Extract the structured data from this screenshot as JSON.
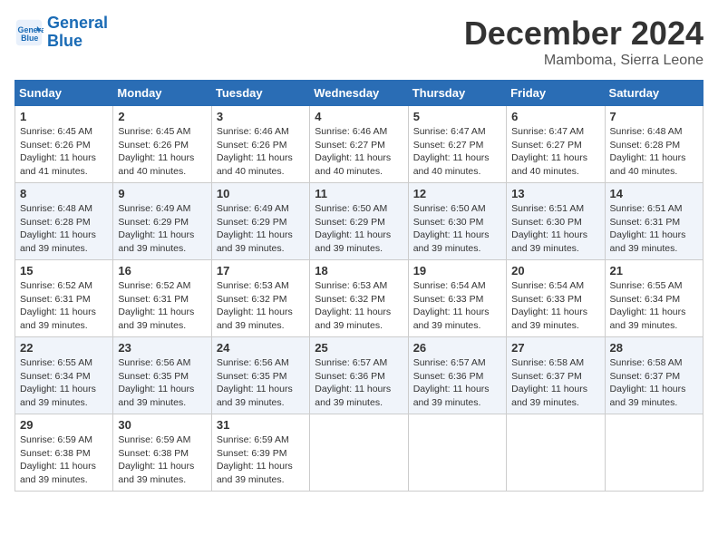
{
  "logo": {
    "line1": "General",
    "line2": "Blue"
  },
  "title": "December 2024",
  "location": "Mamboma, Sierra Leone",
  "days_of_week": [
    "Sunday",
    "Monday",
    "Tuesday",
    "Wednesday",
    "Thursday",
    "Friday",
    "Saturday"
  ],
  "weeks": [
    [
      {
        "day": 1,
        "sunrise": "6:45 AM",
        "sunset": "6:26 PM",
        "daylight": "11 hours and 41 minutes."
      },
      {
        "day": 2,
        "sunrise": "6:45 AM",
        "sunset": "6:26 PM",
        "daylight": "11 hours and 40 minutes."
      },
      {
        "day": 3,
        "sunrise": "6:46 AM",
        "sunset": "6:26 PM",
        "daylight": "11 hours and 40 minutes."
      },
      {
        "day": 4,
        "sunrise": "6:46 AM",
        "sunset": "6:27 PM",
        "daylight": "11 hours and 40 minutes."
      },
      {
        "day": 5,
        "sunrise": "6:47 AM",
        "sunset": "6:27 PM",
        "daylight": "11 hours and 40 minutes."
      },
      {
        "day": 6,
        "sunrise": "6:47 AM",
        "sunset": "6:27 PM",
        "daylight": "11 hours and 40 minutes."
      },
      {
        "day": 7,
        "sunrise": "6:48 AM",
        "sunset": "6:28 PM",
        "daylight": "11 hours and 40 minutes."
      }
    ],
    [
      {
        "day": 8,
        "sunrise": "6:48 AM",
        "sunset": "6:28 PM",
        "daylight": "11 hours and 39 minutes."
      },
      {
        "day": 9,
        "sunrise": "6:49 AM",
        "sunset": "6:29 PM",
        "daylight": "11 hours and 39 minutes."
      },
      {
        "day": 10,
        "sunrise": "6:49 AM",
        "sunset": "6:29 PM",
        "daylight": "11 hours and 39 minutes."
      },
      {
        "day": 11,
        "sunrise": "6:50 AM",
        "sunset": "6:29 PM",
        "daylight": "11 hours and 39 minutes."
      },
      {
        "day": 12,
        "sunrise": "6:50 AM",
        "sunset": "6:30 PM",
        "daylight": "11 hours and 39 minutes."
      },
      {
        "day": 13,
        "sunrise": "6:51 AM",
        "sunset": "6:30 PM",
        "daylight": "11 hours and 39 minutes."
      },
      {
        "day": 14,
        "sunrise": "6:51 AM",
        "sunset": "6:31 PM",
        "daylight": "11 hours and 39 minutes."
      }
    ],
    [
      {
        "day": 15,
        "sunrise": "6:52 AM",
        "sunset": "6:31 PM",
        "daylight": "11 hours and 39 minutes."
      },
      {
        "day": 16,
        "sunrise": "6:52 AM",
        "sunset": "6:31 PM",
        "daylight": "11 hours and 39 minutes."
      },
      {
        "day": 17,
        "sunrise": "6:53 AM",
        "sunset": "6:32 PM",
        "daylight": "11 hours and 39 minutes."
      },
      {
        "day": 18,
        "sunrise": "6:53 AM",
        "sunset": "6:32 PM",
        "daylight": "11 hours and 39 minutes."
      },
      {
        "day": 19,
        "sunrise": "6:54 AM",
        "sunset": "6:33 PM",
        "daylight": "11 hours and 39 minutes."
      },
      {
        "day": 20,
        "sunrise": "6:54 AM",
        "sunset": "6:33 PM",
        "daylight": "11 hours and 39 minutes."
      },
      {
        "day": 21,
        "sunrise": "6:55 AM",
        "sunset": "6:34 PM",
        "daylight": "11 hours and 39 minutes."
      }
    ],
    [
      {
        "day": 22,
        "sunrise": "6:55 AM",
        "sunset": "6:34 PM",
        "daylight": "11 hours and 39 minutes."
      },
      {
        "day": 23,
        "sunrise": "6:56 AM",
        "sunset": "6:35 PM",
        "daylight": "11 hours and 39 minutes."
      },
      {
        "day": 24,
        "sunrise": "6:56 AM",
        "sunset": "6:35 PM",
        "daylight": "11 hours and 39 minutes."
      },
      {
        "day": 25,
        "sunrise": "6:57 AM",
        "sunset": "6:36 PM",
        "daylight": "11 hours and 39 minutes."
      },
      {
        "day": 26,
        "sunrise": "6:57 AM",
        "sunset": "6:36 PM",
        "daylight": "11 hours and 39 minutes."
      },
      {
        "day": 27,
        "sunrise": "6:58 AM",
        "sunset": "6:37 PM",
        "daylight": "11 hours and 39 minutes."
      },
      {
        "day": 28,
        "sunrise": "6:58 AM",
        "sunset": "6:37 PM",
        "daylight": "11 hours and 39 minutes."
      }
    ],
    [
      {
        "day": 29,
        "sunrise": "6:59 AM",
        "sunset": "6:38 PM",
        "daylight": "11 hours and 39 minutes."
      },
      {
        "day": 30,
        "sunrise": "6:59 AM",
        "sunset": "6:38 PM",
        "daylight": "11 hours and 39 minutes."
      },
      {
        "day": 31,
        "sunrise": "6:59 AM",
        "sunset": "6:39 PM",
        "daylight": "11 hours and 39 minutes."
      },
      null,
      null,
      null,
      null
    ]
  ]
}
